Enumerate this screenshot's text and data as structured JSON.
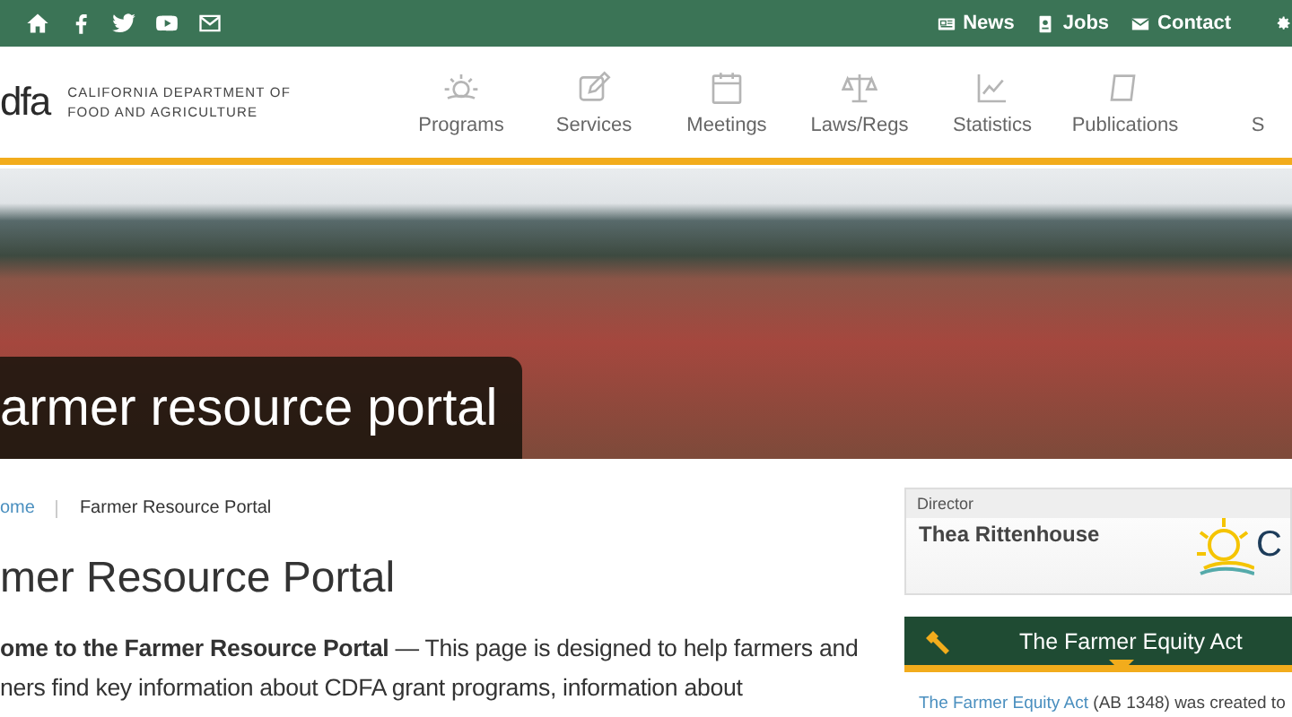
{
  "top_bar": {
    "links": [
      {
        "label": "News"
      },
      {
        "label": "Jobs"
      },
      {
        "label": "Contact"
      }
    ]
  },
  "header": {
    "logo_text": "dfa",
    "org_lines": [
      "CALIFORNIA DEPARTMENT OF",
      "FOOD AND AGRICULTURE"
    ],
    "nav": [
      {
        "label": "Programs"
      },
      {
        "label": "Services"
      },
      {
        "label": "Meetings"
      },
      {
        "label": "Laws/Regs"
      },
      {
        "label": "Statistics"
      },
      {
        "label": "Publications"
      },
      {
        "label": "S"
      }
    ]
  },
  "hero": {
    "title": "armer resource portal"
  },
  "breadcrumb": [
    {
      "label": "ome"
    },
    {
      "label": "Farmer Resource Portal"
    }
  ],
  "heading": "mer Resource Portal",
  "intro": "**ome to the Farmer Resource Portal** — This page is designed to help farmers and\nners find key information about CDFA grant programs, information about",
  "director": {
    "label": "Director",
    "name": "Thea Rittenhouse",
    "logo_text": "C"
  },
  "equity_box": {
    "title": "The Farmer Equity Act",
    "link": "The Farmer Equity Act",
    "text": " (AB 1348) was created to"
  }
}
